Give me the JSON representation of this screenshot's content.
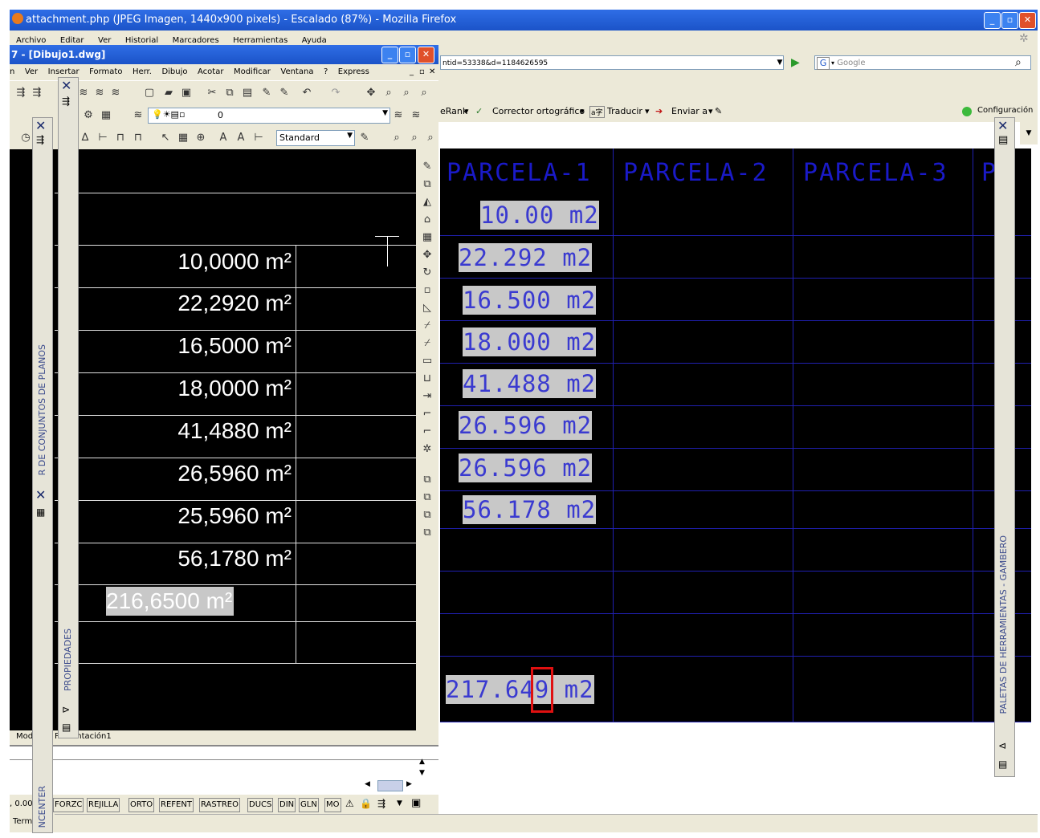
{
  "firefox": {
    "title": "attachment.php (JPEG Imagen, 1440x900 pixels) - Escalado (87%) - Mozilla Firefox",
    "menu": [
      "Archivo",
      "Editar",
      "Ver",
      "Historial",
      "Marcadores",
      "Herramientas",
      "Ayuda"
    ],
    "url": "ntid=53338&d=1184626595",
    "search_placeholder": "Google",
    "google_toolbar": {
      "pagerank": "eRank",
      "spell": "Corrector ortográfico",
      "translate": "Traducir",
      "send": "Enviar a",
      "settings": "Configuración"
    },
    "image": {
      "headers": [
        "PARCELA-1",
        "PARCELA-2",
        "PARCELA-3",
        "P"
      ],
      "values": [
        "10.00 m2",
        "22.292 m2",
        "16.500 m2",
        "18.000 m2",
        "41.488 m2",
        "26.596 m2",
        "26.596 m2",
        "56.178 m2"
      ],
      "total": "217.649 m2"
    }
  },
  "autocad": {
    "title": "7 - [Dibujo1.dwg]",
    "menu": [
      "n",
      "Ver",
      "Insertar",
      "Formato",
      "Herr.",
      "Dibujo",
      "Acotar",
      "Modificar",
      "Ventana",
      "?",
      "Express"
    ],
    "layer_value": "0",
    "textstyle": "Standard",
    "values": [
      "10,0000 m²",
      "22,2920 m²",
      "16,5000 m²",
      "18,0000 m²",
      "41,4880 m²",
      "26,5960 m²",
      "25,5960 m²",
      "56,1780 m²"
    ],
    "total": "216,6500 m²",
    "tabs": [
      "Mod",
      "Presentación1"
    ],
    "status": {
      "coords": ", 0.00",
      "buttons": [
        "FORZC",
        "REJILLA",
        "ORTO",
        "REFENT",
        "RASTREO",
        "DUCS",
        "DIN",
        "GLN",
        "MO"
      ]
    },
    "term": "Term"
  },
  "palettes": {
    "sheet_set": "R DE CONJUNTOS DE PLANOS",
    "properties": "PROPIEDADES",
    "design_center": "NCENTER",
    "tool_palettes": "PALETAS DE HERRAMIENTAS - GAMBERO"
  }
}
